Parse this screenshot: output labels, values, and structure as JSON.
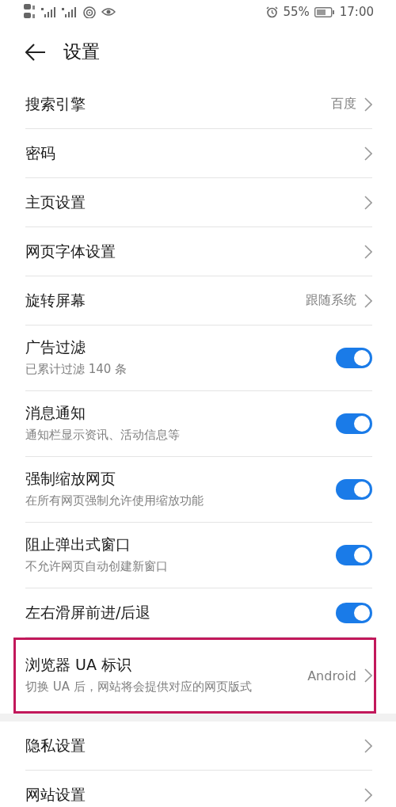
{
  "status_bar": {
    "battery": "55%",
    "time": "17:00"
  },
  "header": {
    "title": "设置"
  },
  "sections": [
    {
      "items": [
        {
          "kind": "link",
          "title": "搜索引擎",
          "value": "百度"
        },
        {
          "kind": "link",
          "title": "密码"
        },
        {
          "kind": "link",
          "title": "主页设置"
        },
        {
          "kind": "link",
          "title": "网页字体设置"
        },
        {
          "kind": "link",
          "title": "旋转屏幕",
          "value": "跟随系统"
        },
        {
          "kind": "toggle",
          "title": "广告过滤",
          "subtitle": "已累计过滤 140 条",
          "on": true
        },
        {
          "kind": "toggle",
          "title": "消息通知",
          "subtitle": "通知栏显示资讯、活动信息等",
          "on": true
        },
        {
          "kind": "toggle",
          "title": "强制缩放网页",
          "subtitle": "在所有网页强制允许使用缩放功能",
          "on": true
        },
        {
          "kind": "toggle",
          "title": "阻止弹出式窗口",
          "subtitle": "不允许网页自动创建新窗口",
          "on": true
        },
        {
          "kind": "toggle",
          "title": "左右滑屏前进/后退",
          "on": true
        },
        {
          "kind": "link",
          "title": "浏览器 UA 标识",
          "subtitle": "切换 UA 后，网站将会提供对应的网页版式",
          "value": "Android",
          "highlighted": true
        }
      ]
    },
    {
      "items": [
        {
          "kind": "link",
          "title": "隐私设置"
        },
        {
          "kind": "link",
          "title": "网站设置"
        }
      ]
    }
  ]
}
